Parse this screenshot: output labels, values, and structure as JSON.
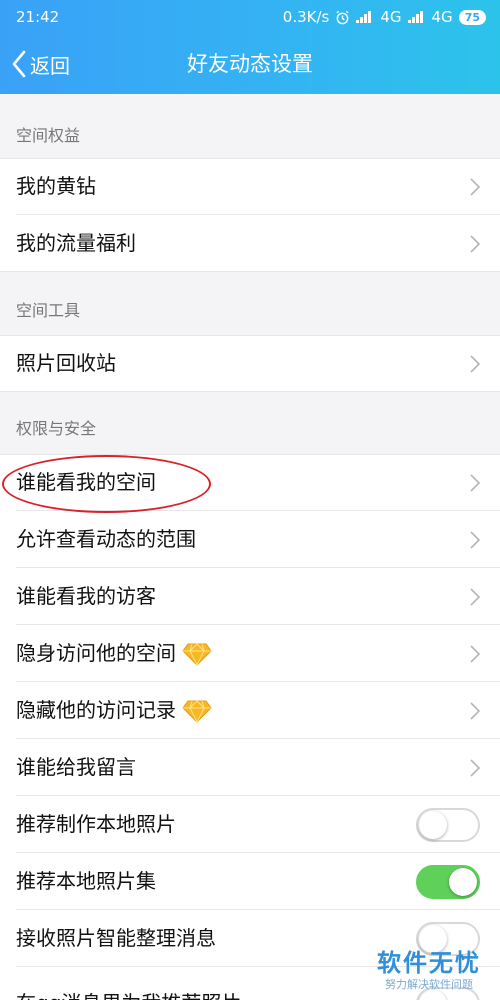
{
  "status_bar": {
    "time": "21:42",
    "net_speed": "0.3K/s",
    "alarm_icon": "alarm-clock-icon",
    "network1": "4G",
    "network2": "4G",
    "battery": "75"
  },
  "navbar": {
    "back_label": "返回",
    "title": "好友动态设置"
  },
  "sections": [
    {
      "header": "空间权益"
    },
    {
      "header": "空间工具"
    },
    {
      "header": "权限与安全"
    }
  ],
  "rows": [
    {
      "label": "我的黄钻",
      "type": "link"
    },
    {
      "label": "我的流量福利",
      "type": "link"
    },
    {
      "label": "照片回收站",
      "type": "link"
    },
    {
      "label": "谁能看我的空间",
      "type": "link"
    },
    {
      "label": "允许查看动态的范围",
      "type": "link"
    },
    {
      "label": "谁能看我的访客",
      "type": "link"
    },
    {
      "label": "隐身访问他的空间",
      "type": "link",
      "badge_icon": "diamond-vip-icon"
    },
    {
      "label": "隐藏他的访问记录",
      "type": "link",
      "badge_icon": "diamond-vip-icon"
    },
    {
      "label": "谁能给我留言",
      "type": "link"
    },
    {
      "label": "推荐制作本地照片",
      "type": "toggle",
      "on": false
    },
    {
      "label": "推荐本地照片集",
      "type": "toggle",
      "on": true
    },
    {
      "label": "接收照片智能整理消息",
      "type": "toggle",
      "on": false
    },
    {
      "label": "在qq消息里为我推荐照片",
      "type": "toggle",
      "on": false
    }
  ],
  "colors": {
    "header_start": "#3aa1f7",
    "header_end": "#2cc3ea",
    "toggle_on": "#5fd15a",
    "annotation": "#d9232b"
  },
  "watermark": {
    "main": "软件无忧",
    "sub": "努力解决软件问题"
  }
}
